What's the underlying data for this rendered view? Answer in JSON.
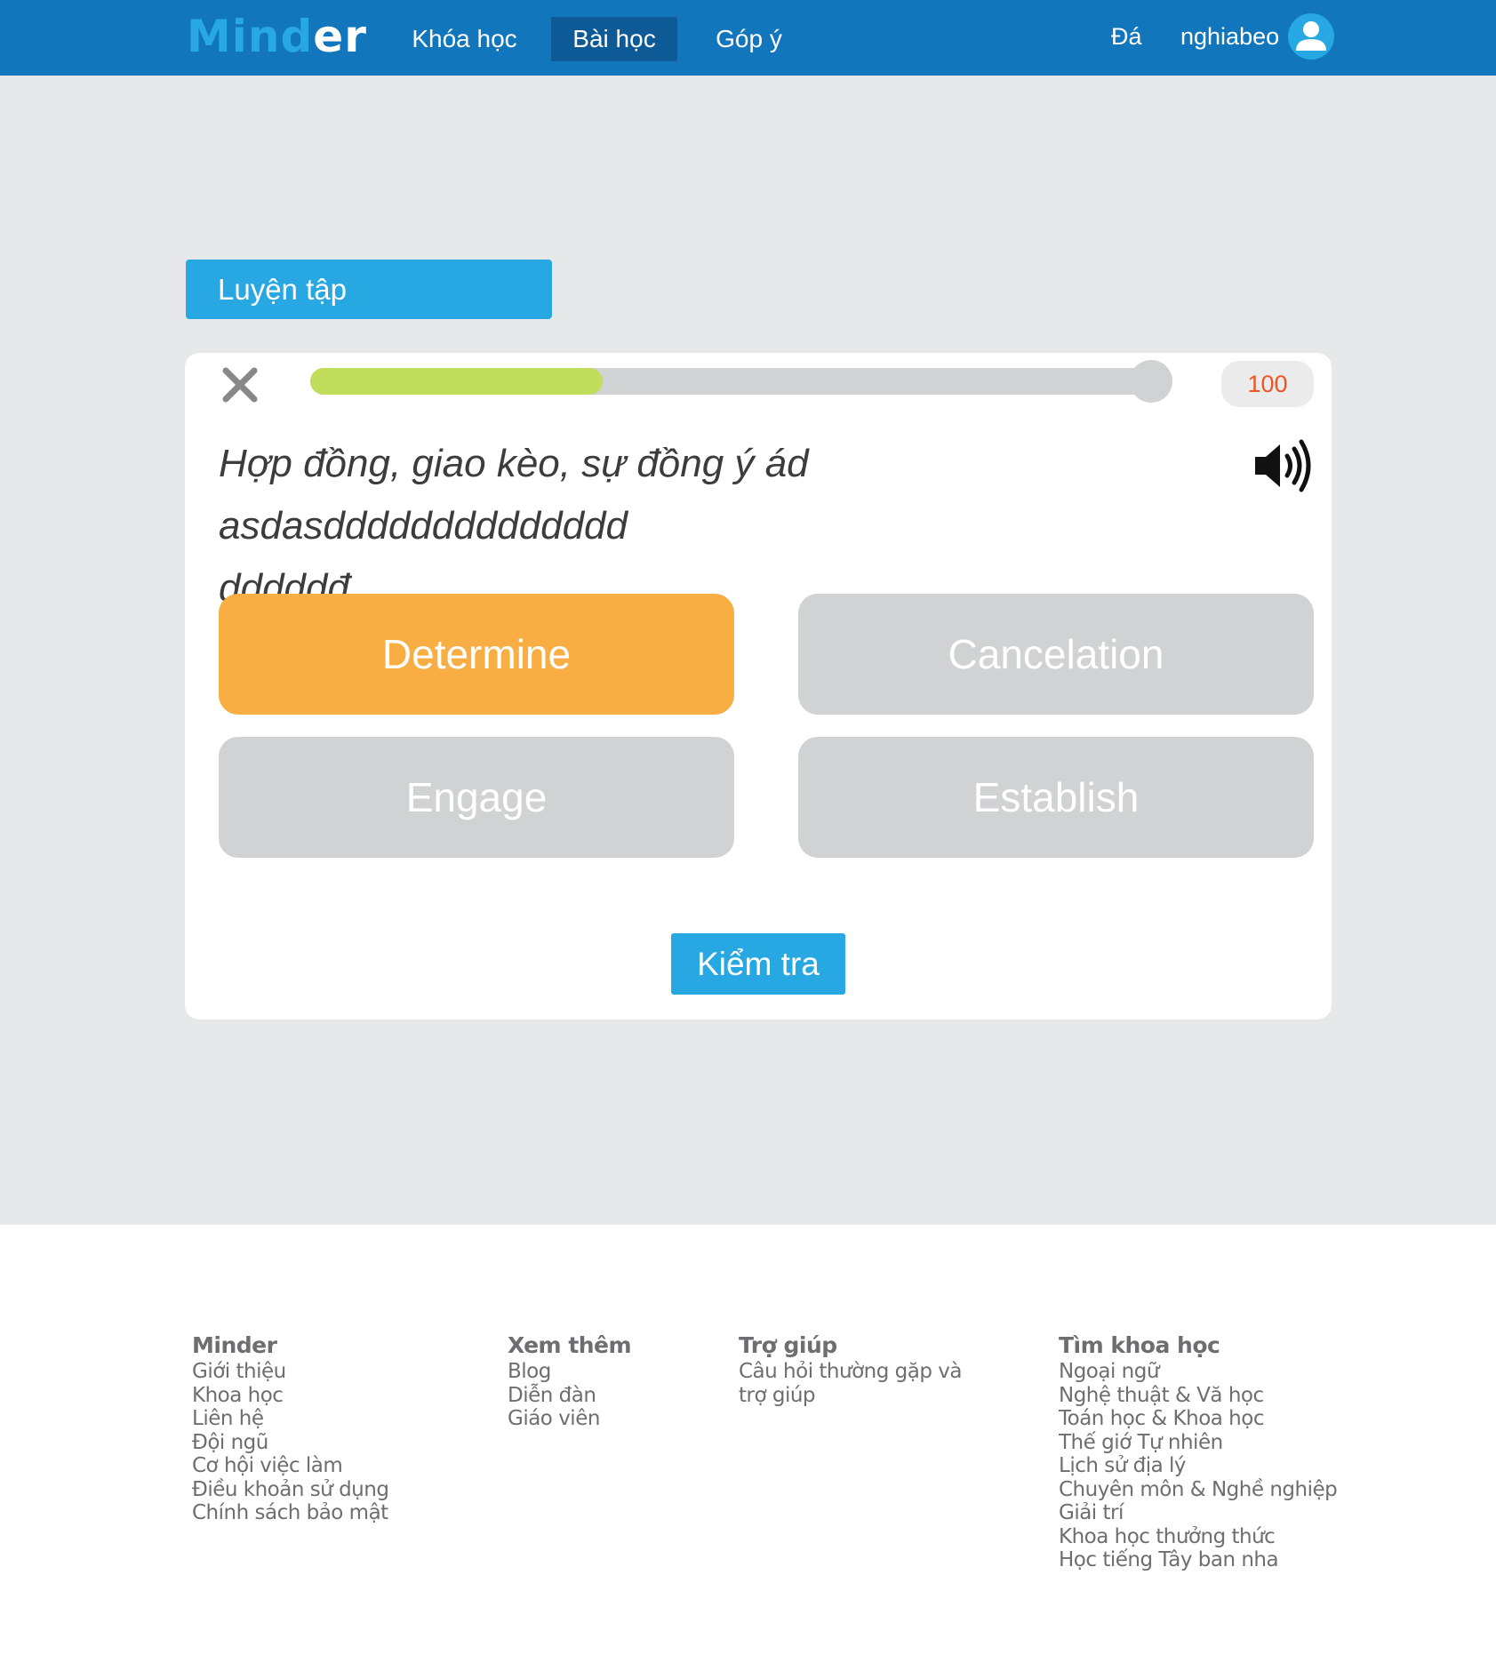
{
  "header": {
    "logo_part1": "Mind",
    "logo_part2": "er",
    "nav": [
      {
        "label": "Khóa học"
      },
      {
        "label": "Bài học"
      },
      {
        "label": "Góp ý"
      }
    ],
    "dropdown_label": "Đá",
    "username": "nghiabeo",
    "avatar_icon": "user-icon"
  },
  "practice": {
    "section_title": "Luyện tập",
    "progress_fraction": 0.35,
    "score": "100",
    "question_line1": "Hợp đồng, giao kèo, sự đồng ý ád asdasdddddddddddddd",
    "question_line2": "dddddđ",
    "options": [
      {
        "label": "Determine",
        "selected": true
      },
      {
        "label": "Cancelation",
        "selected": false
      },
      {
        "label": "Engage",
        "selected": false
      },
      {
        "label": "Establish",
        "selected": false
      }
    ],
    "check_button": "Kiểm tra",
    "colors": {
      "header": "#1276bd",
      "accent": "#27a8e3",
      "selected_option": "#f9ae43",
      "idle_option": "#d1d2d4",
      "progress_fill": "#c2dc5b",
      "score_text": "#f05423"
    }
  },
  "footer": {
    "columns": [
      {
        "heading": "Minder",
        "links": [
          "Giới thiệu",
          "Khoa học",
          "Liên hệ",
          "Đội ngũ",
          "Cơ hội việc làm",
          "Điều khoản sử dụng",
          "Chính sách bảo mật"
        ]
      },
      {
        "heading": "Xem thêm",
        "links": [
          "Blog",
          "Diễn đàn",
          "Giáo viên"
        ]
      },
      {
        "heading": "Trợ giúp",
        "links": [
          "Câu hỏi thường gặp và",
          "trợ giúp"
        ]
      },
      {
        "heading": "Tìm khoa học",
        "links": [
          "Ngoại ngữ",
          "Nghệ thuật & Vă học",
          "Toán học & Khoa học",
          "Thế giớ Tự nhiên",
          "Lịch sử địa lý",
          "Chuyên môn & Nghề nghiệp",
          "Giải trí",
          "Khoa học thưởng thức",
          "Học tiếng Tây ban nha"
        ]
      }
    ]
  }
}
